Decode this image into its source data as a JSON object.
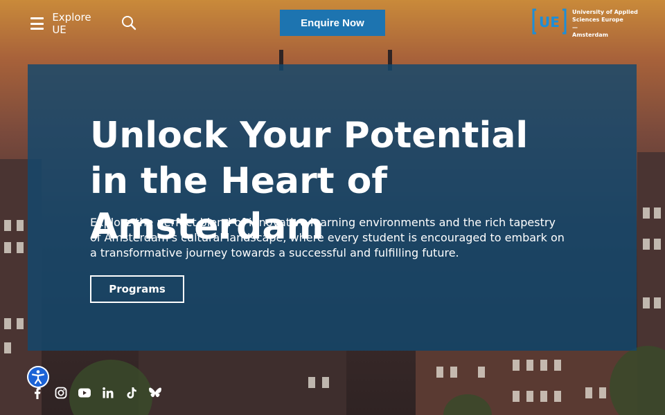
{
  "header": {
    "menu_label": "Explore UE",
    "menu_icon": "hamburger-icon",
    "search_icon": "search-icon",
    "enquire_label": "Enquire Now",
    "logo": {
      "mark_text": "UE",
      "line1": "University of Applied",
      "line2": "Sciences Europe",
      "line3": "—",
      "line4": "Amsterdam"
    }
  },
  "hero": {
    "title": "Unlock Your Potential in the Heart of Amsterdam",
    "description": "Explore the perfect blend of innovative learning environments and the rich tapestry of Amsterdam's cultural landscape, where every student is encouraged to embark on a transformative journey towards a successful and fulfilling future.",
    "button_label": "Programs"
  },
  "accessibility": {
    "icon": "accessibility-icon"
  },
  "social": [
    {
      "name": "facebook",
      "icon": "facebook-icon"
    },
    {
      "name": "instagram",
      "icon": "instagram-icon"
    },
    {
      "name": "youtube",
      "icon": "youtube-icon"
    },
    {
      "name": "linkedin",
      "icon": "linkedin-icon"
    },
    {
      "name": "tiktok",
      "icon": "tiktok-icon"
    },
    {
      "name": "bluesky",
      "icon": "bluesky-icon"
    }
  ],
  "colors": {
    "accent": "#1d74b0",
    "hero_overlay": "#12486e",
    "accessibility": "#1c63d6"
  }
}
